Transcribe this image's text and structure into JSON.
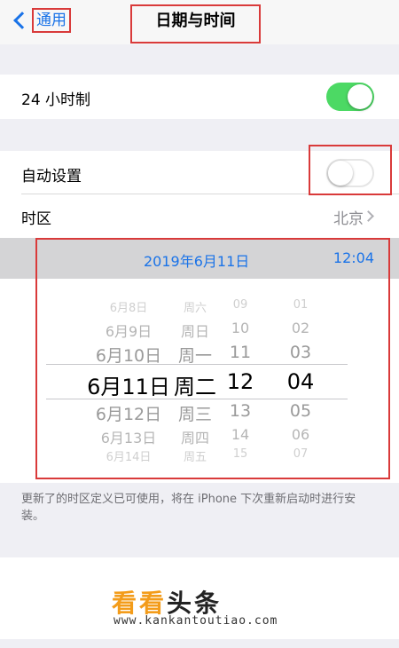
{
  "nav": {
    "back_label": "通用",
    "title": "日期与时间"
  },
  "settings": {
    "hour24": {
      "label": "24 小时制",
      "on": true
    },
    "auto_set": {
      "label": "自动设置",
      "on": false
    },
    "timezone": {
      "label": "时区",
      "value": "北京"
    }
  },
  "date_bar": {
    "date": "2019年6月11日",
    "time": "12:04"
  },
  "picker": {
    "rows": [
      {
        "date": "6月8日",
        "weekday": "周六",
        "hour": "09",
        "minute": "01"
      },
      {
        "date": "6月9日",
        "weekday": "周日",
        "hour": "10",
        "minute": "02"
      },
      {
        "date": "6月10日",
        "weekday": "周一",
        "hour": "11",
        "minute": "03"
      },
      {
        "date": "6月11日",
        "weekday": "周二",
        "hour": "12",
        "minute": "04"
      },
      {
        "date": "6月12日",
        "weekday": "周三",
        "hour": "13",
        "minute": "05"
      },
      {
        "date": "6月13日",
        "weekday": "周四",
        "hour": "14",
        "minute": "06"
      },
      {
        "date": "6月14日",
        "weekday": "周五",
        "hour": "15",
        "minute": "07"
      }
    ]
  },
  "footer_note": "更新了的时区定义已可使用，将在 iPhone 下次重新启动时进行安装。",
  "watermark": {
    "logo_a": "看看",
    "logo_b": "头条",
    "url": "www.kankantoutiao.com"
  },
  "colors": {
    "accent": "#1a73e8",
    "toggle_on": "#4cd964",
    "annotation": "#d93a3a"
  }
}
